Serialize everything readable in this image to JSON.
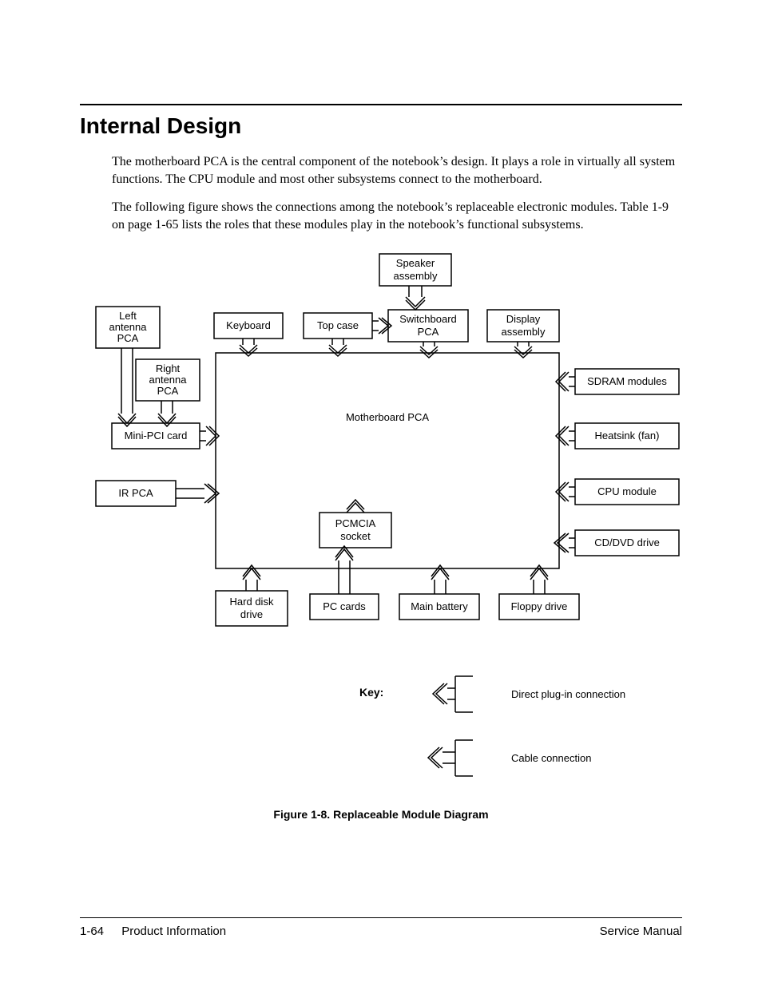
{
  "heading": "Internal Design",
  "para1": "The motherboard PCA is the central component of the notebook’s design. It plays a role in virtually all system functions. The CPU module and most other subsystems connect to the motherboard.",
  "para2": "The following figure shows the connections among the notebook’s replaceable electronic modules. Table 1-9 on page 1-65 lists the roles that these modules play in the notebook’s functional subsystems.",
  "diagram": {
    "center": "Motherboard PCA",
    "nodes": {
      "speaker": [
        "Speaker",
        "assembly"
      ],
      "left_antenna": [
        "Left",
        "antenna",
        "PCA"
      ],
      "keyboard": "Keyboard",
      "top_case": "Top case",
      "switchboard": [
        "Switchboard",
        "PCA"
      ],
      "display": [
        "Display",
        "assembly"
      ],
      "right_antenna": [
        "Right",
        "antenna",
        "PCA"
      ],
      "sdram": "SDRAM modules",
      "mini_pci": "Mini-PCI card",
      "heatsink": "Heatsink (fan)",
      "ir_pca": "IR PCA",
      "cpu": "CPU module",
      "pcmcia": [
        "PCMCIA",
        "socket"
      ],
      "cddvd": "CD/DVD drive",
      "hdd": [
        "Hard disk",
        "drive"
      ],
      "pc_cards": "PC cards",
      "main_batt": "Main battery",
      "floppy": "Floppy drive"
    },
    "key_label": "Key:",
    "key_direct": "Direct plug-in connection",
    "key_cable": "Cable connection"
  },
  "caption": "Figure 1-8. Replaceable Module Diagram",
  "footer": {
    "page_num": "1-64",
    "section": "Product Information",
    "manual": "Service Manual"
  }
}
